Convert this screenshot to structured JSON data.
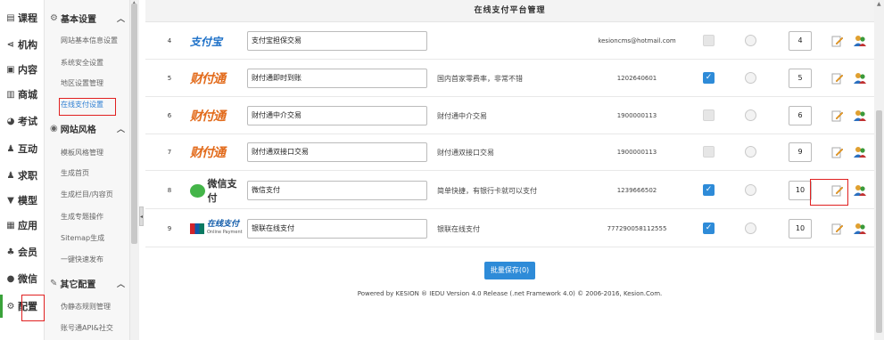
{
  "leftnav": {
    "items": [
      {
        "label": "课程",
        "icon": "book-icon"
      },
      {
        "label": "机构",
        "icon": "share-icon"
      },
      {
        "label": "内容",
        "icon": "document-icon"
      },
      {
        "label": "商城",
        "icon": "shop-icon"
      },
      {
        "label": "考试",
        "icon": "exam-icon"
      },
      {
        "label": "互动",
        "icon": "people-icon"
      },
      {
        "label": "求职",
        "icon": "job-icon"
      },
      {
        "label": "模型",
        "icon": "model-icon"
      },
      {
        "label": "应用",
        "icon": "apps-icon"
      },
      {
        "label": "会员",
        "icon": "member-icon"
      },
      {
        "label": "微信",
        "icon": "wechat-icon"
      },
      {
        "label": "配置",
        "icon": "gear-icon"
      }
    ]
  },
  "subnav": {
    "groups": [
      {
        "title": "基本设置",
        "links": [
          "网站基本信息设置",
          "系统安全设置",
          "地区设置管理",
          "在线支付设置"
        ]
      },
      {
        "title": "网站风格",
        "links": [
          "模板风格管理",
          "生成首页",
          "生成栏目/内容页",
          "生成专题操作",
          "Sitemap生成",
          "一键快速发布"
        ]
      },
      {
        "title": "其它配置",
        "links": [
          "伪静态规则管理",
          "账号通API&社交"
        ]
      }
    ]
  },
  "main": {
    "title": "在线支付平台管理",
    "rows": [
      {
        "idx": "4",
        "logo": "alipay",
        "logo_text": "支付宝",
        "name": "支付宝担保交易",
        "desc": "",
        "account": "kesioncms@hotmail.com",
        "checked": false,
        "order": "4"
      },
      {
        "idx": "5",
        "logo": "tenpay",
        "logo_text": "财付通",
        "name": "财付通即时到账",
        "desc": "国内首家零费率，非常不错",
        "account": "1202640601",
        "checked": true,
        "order": "5"
      },
      {
        "idx": "6",
        "logo": "tenpay",
        "logo_text": "财付通",
        "name": "财付通中介交易",
        "desc": "财付通中介交易",
        "account": "1900000113",
        "checked": false,
        "order": "6"
      },
      {
        "idx": "7",
        "logo": "tenpay",
        "logo_text": "财付通",
        "name": "财付通双接口交易",
        "desc": "财付通双接口交易",
        "account": "1900000113",
        "checked": false,
        "order": "9"
      },
      {
        "idx": "8",
        "logo": "wechat",
        "logo_text": "微信支付",
        "name": "微信支付",
        "desc": "简单快捷，有银行卡就可以支付",
        "account": "1239666502",
        "checked": true,
        "order": "10"
      },
      {
        "idx": "9",
        "logo": "unionpay",
        "logo_text": "在线支付",
        "logo_sub": "Online Payment",
        "name": "银联在线支付",
        "desc": "银联在线支付",
        "account": "777290058112555",
        "checked": true,
        "order": "10"
      }
    ],
    "save_button": "批量保存(0)",
    "footer": "Powered by KESION ® IEDU Version 4.0 Release (.net Framework 4.0) © 2006-2016, Kesion.Com."
  },
  "colors": {
    "accent": "#2e8bd8",
    "highlight_box": "#e02020",
    "active_bar": "#3aa23a"
  }
}
